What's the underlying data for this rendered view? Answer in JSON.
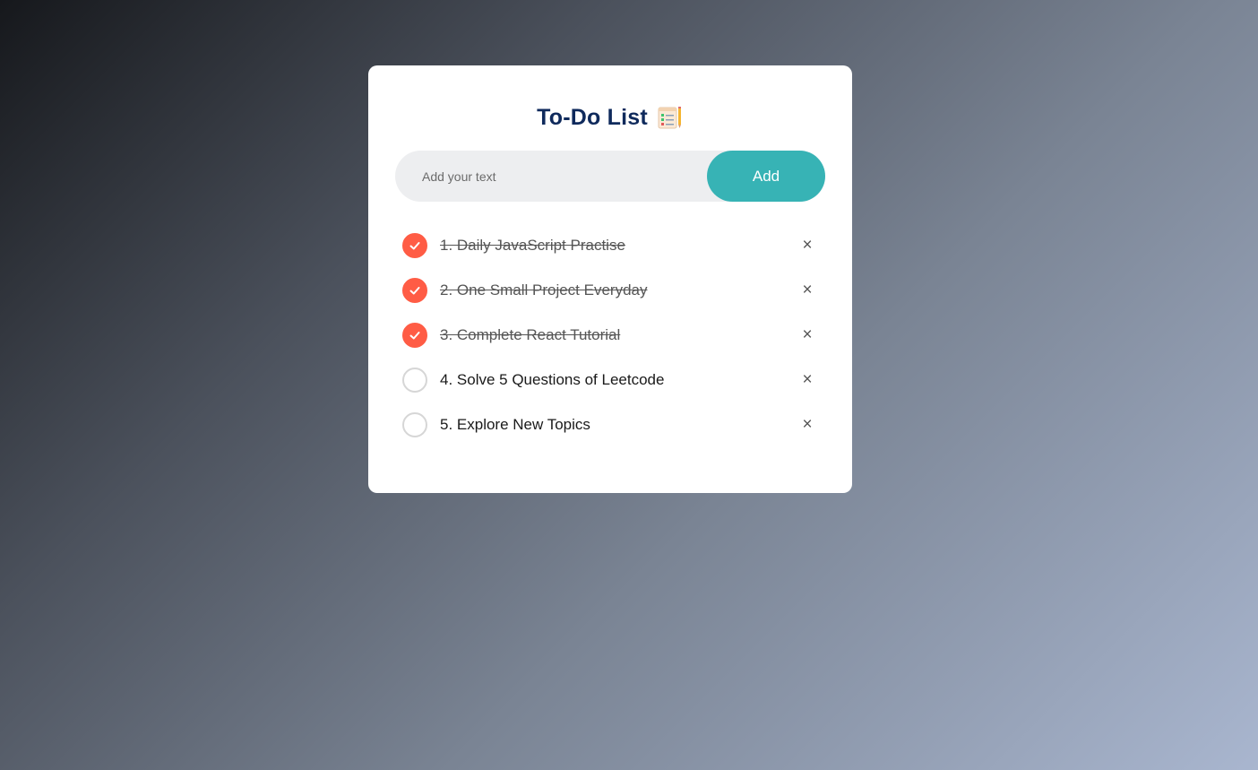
{
  "app": {
    "title": "To-Do List",
    "title_icon": "notepad-icon"
  },
  "input": {
    "placeholder": "Add your text",
    "value": ""
  },
  "add_button": {
    "label": "Add"
  },
  "colors": {
    "accent": "#37b3b5",
    "checked": "#ff5c45",
    "title": "#0f2a5c"
  },
  "tasks": [
    {
      "label": "1. Daily JavaScript Practise",
      "done": true
    },
    {
      "label": "2. One Small Project Everyday",
      "done": true
    },
    {
      "label": "3. Complete React Tutorial",
      "done": true
    },
    {
      "label": "4. Solve 5 Questions of Leetcode",
      "done": false
    },
    {
      "label": "5. Explore New Topics",
      "done": false
    }
  ],
  "delete_symbol": "×"
}
